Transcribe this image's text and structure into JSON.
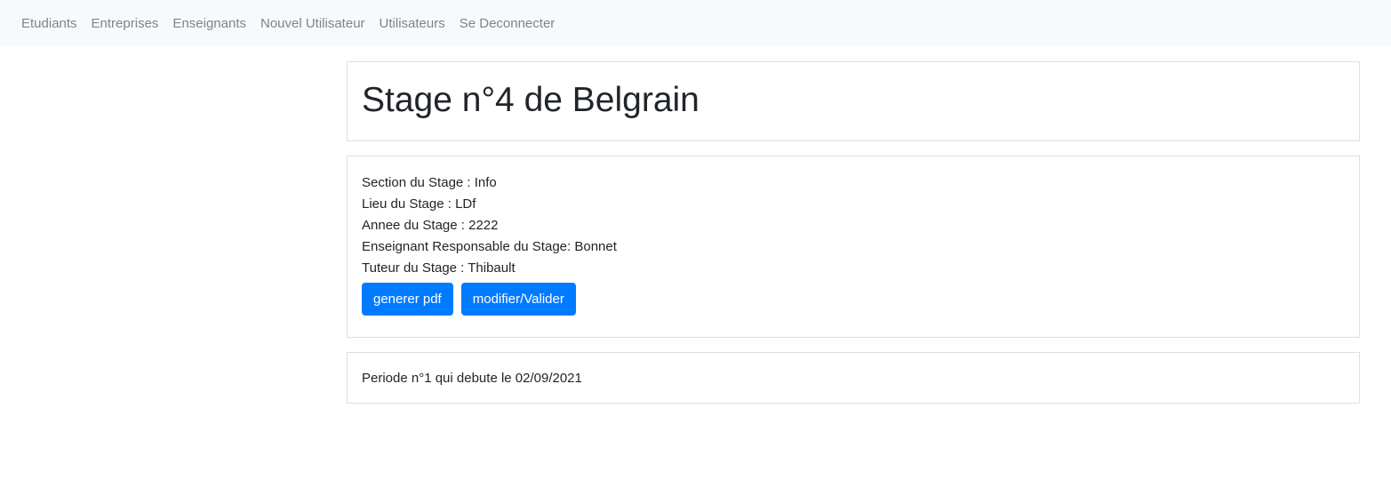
{
  "navbar": {
    "items": [
      {
        "label": "Etudiants"
      },
      {
        "label": "Entreprises"
      },
      {
        "label": "Enseignants"
      },
      {
        "label": "Nouvel Utilisateur"
      },
      {
        "label": "Utilisateurs"
      },
      {
        "label": "Se Deconnecter"
      }
    ]
  },
  "stage": {
    "title": "Stage n°4 de Belgrain",
    "info": {
      "section": "Section du Stage : Info",
      "lieu": "Lieu du Stage : LDf",
      "annee": "Annee du Stage : 2222",
      "enseignant": "Enseignant Responsable du Stage: Bonnet",
      "tuteur": "Tuteur du Stage : Thibault"
    },
    "buttons": {
      "pdf_label": "generer pdf",
      "modifier_label": "modifier/Valider"
    }
  },
  "periode": {
    "text": "Periode n°1 qui debute le 02/09/2021"
  },
  "colors": {
    "navbar_bg": "#f8f9fa",
    "nav_link": "#808487",
    "primary_button": "#007bff",
    "card_border": "#dfdfdf",
    "text": "#212529"
  }
}
